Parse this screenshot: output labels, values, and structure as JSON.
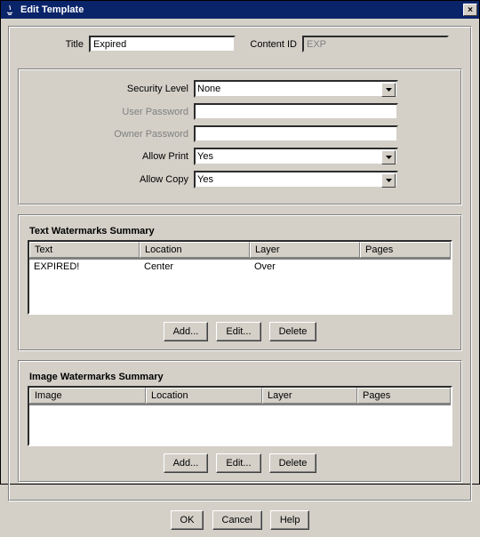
{
  "window": {
    "title": "Edit Template"
  },
  "topFields": {
    "titleLabel": "Title",
    "titleValue": "Expired",
    "contentIdLabel": "Content ID",
    "contentIdValue": "EXP"
  },
  "security": {
    "levelLabel": "Security Level",
    "levelValue": "None",
    "userPwdLabel": "User Password",
    "userPwdValue": "",
    "ownerPwdLabel": "Owner Password",
    "ownerPwdValue": "",
    "allowPrintLabel": "Allow Print",
    "allowPrintValue": "Yes",
    "allowCopyLabel": "Allow Copy",
    "allowCopyValue": "Yes"
  },
  "textWatermarks": {
    "heading": "Text Watermarks Summary",
    "columns": {
      "c0": "Text",
      "c1": "Location",
      "c2": "Layer",
      "c3": "Pages"
    },
    "row0": {
      "c0": "EXPIRED!",
      "c1": "Center",
      "c2": "Over",
      "c3": ""
    }
  },
  "imageWatermarks": {
    "heading": "Image Watermarks Summary",
    "columns": {
      "c0": "Image",
      "c1": "Location",
      "c2": "Layer",
      "c3": "Pages"
    }
  },
  "buttons": {
    "add": "Add...",
    "edit": "Edit...",
    "delete": "Delete",
    "ok": "OK",
    "cancel": "Cancel",
    "help": "Help"
  }
}
